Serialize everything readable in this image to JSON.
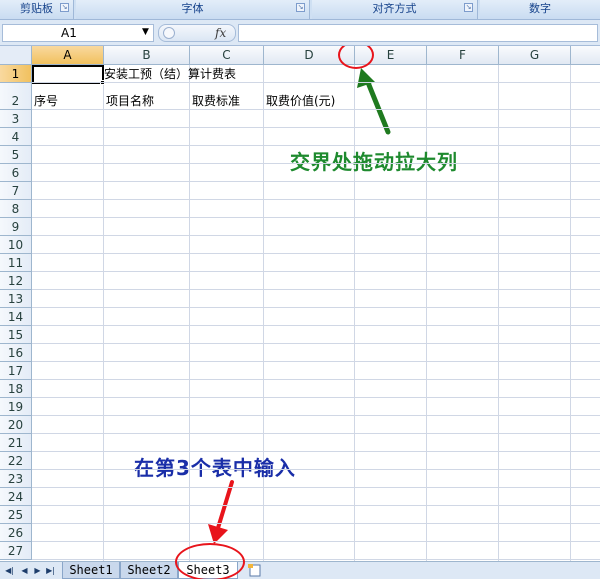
{
  "ribbon": {
    "groups": [
      {
        "label": "剪贴板"
      },
      {
        "label": "字体"
      },
      {
        "label": "对齐方式"
      },
      {
        "label": "数字"
      }
    ]
  },
  "formula_bar": {
    "name_box": "A1",
    "fx_label": "fx",
    "formula": ""
  },
  "columns": [
    "A",
    "B",
    "C",
    "D",
    "E",
    "F",
    "G"
  ],
  "rows": [
    "1",
    "2",
    "3",
    "4",
    "5",
    "6",
    "7",
    "8",
    "9",
    "10",
    "11",
    "12",
    "13",
    "14",
    "15",
    "16",
    "17",
    "18",
    "19",
    "20",
    "21",
    "22",
    "23",
    "24",
    "25",
    "26",
    "27"
  ],
  "cells": {
    "B1": "安装工预（结）算计费表",
    "A2": "序号",
    "B2": "项目名称",
    "C2": "取费标准",
    "D2": "取费价值(元)"
  },
  "annotations": {
    "drag_hint": "交界处拖动拉大列",
    "sheet_hint": "在第3个表中输入",
    "colors": {
      "green_text": "#1e8a2e",
      "blue_text": "#1a2ea8",
      "red": "#e8141b",
      "green_arrow": "#1f7a1f"
    }
  },
  "sheets": {
    "tabs": [
      "Sheet1",
      "Sheet2",
      "Sheet3"
    ],
    "active": "Sheet3"
  },
  "nav_icons": [
    "first-sheet-icon",
    "prev-sheet-icon",
    "next-sheet-icon",
    "last-sheet-icon"
  ]
}
